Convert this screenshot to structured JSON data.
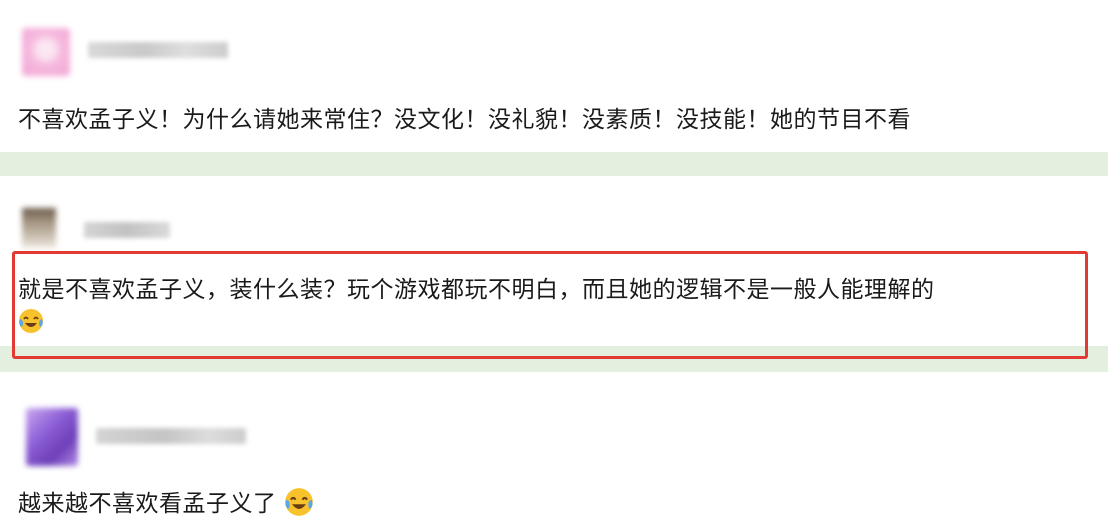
{
  "comments": [
    {
      "username": "",
      "avatar_color": "#f4b6dc",
      "text": "不喜欢孟子义！为什么请她来常住？没文化！没礼貌！没素质！没技能！她的节目不看",
      "emoji": ""
    },
    {
      "username": "",
      "avatar_color": "#9c8a78",
      "text": "就是不喜欢孟子义，装什么装？玩个游戏都玩不明白，而且她的逻辑不是一般人能理解的",
      "emoji": "laughing-crying-emoji",
      "highlighted": true
    },
    {
      "username": "",
      "avatar_color": "#8b5fd0",
      "text": "越来越不喜欢看孟子义了",
      "emoji": "laughing-crying-emoji"
    }
  ],
  "colors": {
    "divider": "#e3efdf",
    "highlight_border": "#e23a33",
    "text": "#1a1a1a"
  }
}
